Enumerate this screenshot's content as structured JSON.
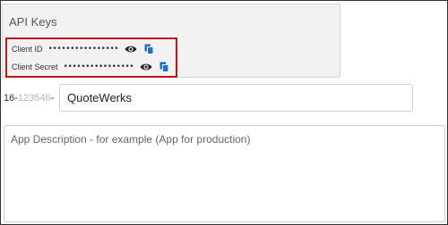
{
  "api_keys": {
    "title": "API Keys",
    "client_id": {
      "label": "Client ID",
      "masked_value": "••••••••••••••••"
    },
    "client_secret": {
      "label": "Client Secret",
      "masked_value": "••••••••••••••••"
    }
  },
  "app_name": {
    "prefix_start": "16-",
    "prefix_number": "123546",
    "prefix_end": "-",
    "value": "QuoteWerks"
  },
  "app_description": {
    "placeholder": "App Description - for example (App for production)",
    "value": ""
  },
  "colors": {
    "highlight_border": "#c0141a",
    "panel_background": "#f2f2f2",
    "copy_icon": "#1e74c8"
  },
  "icons": {
    "reveal": "eye-icon",
    "copy": "copy-icon"
  }
}
